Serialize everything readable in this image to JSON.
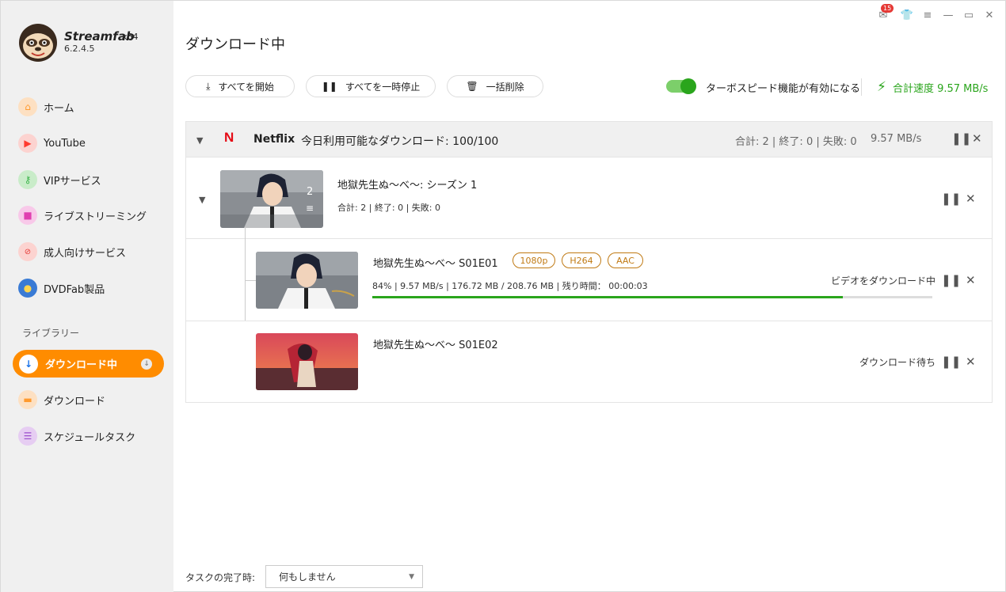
{
  "app": {
    "brand": "Streamfab",
    "arch": "x64",
    "version": "6.2.4.5",
    "notification_count": "15"
  },
  "sidebar": {
    "items": [
      {
        "label": "ホーム",
        "icon": "home-icon",
        "color": "#ff9a2e"
      },
      {
        "label": "YouTube",
        "icon": "youtube-icon",
        "color": "#ff3b30"
      },
      {
        "label": "VIPサービス",
        "icon": "key-icon",
        "color": "#3cb44b"
      },
      {
        "label": "ライブストリーミング",
        "icon": "video-camera-icon",
        "color": "#e040b0"
      },
      {
        "label": "成人向けサービス",
        "icon": "no-18-icon",
        "color": "#e53935"
      },
      {
        "label": "DVDFab製品",
        "icon": "dvdfab-logo-icon",
        "color": "#3a7bd5"
      }
    ],
    "library_label": "ライブラリー",
    "library": [
      {
        "label": "ダウンロード中",
        "icon": "download-arrow-icon",
        "active": true
      },
      {
        "label": "ダウンロード",
        "icon": "folder-icon",
        "color": "#ff9a2e"
      },
      {
        "label": "スケジュールタスク",
        "icon": "schedule-list-icon",
        "color": "#9c4dcc"
      }
    ]
  },
  "main": {
    "title": "ダウンロード中",
    "toolbar": {
      "start_all": "すべてを開始",
      "pause_all": "すべてを一時停止",
      "delete_all": "一括削除"
    },
    "turbo": {
      "label": "ターボスピード機能が有効になる",
      "enabled": true
    },
    "total_speed": "合計速度 9.57 MB/s",
    "group": {
      "service": "Netflix",
      "quota": "今日利用可能なダウンロード: 100/100",
      "stats": "合計: 2 | 終了: 0 | 失敗: 0",
      "speed": "9.57 MB/s"
    },
    "season": {
      "title": "地獄先生ぬ〜べ〜: シーズン 1",
      "count": "2",
      "stats": "合計: 2  |  終了: 0  |  失敗: 0"
    },
    "episodes": [
      {
        "title": "地獄先生ぬ〜べ〜 S01E01",
        "tags": [
          "1080p",
          "H264",
          "AAC"
        ],
        "stats": "84%  |  9.57 MB/s  |  176.72 MB / 208.76 MB  |  残り時間： 00:00:03",
        "progress": 0.84,
        "status": "ビデオをダウンロード中"
      },
      {
        "title": "地獄先生ぬ〜べ〜 S01E02",
        "status": "ダウンロード待ち"
      }
    ],
    "footer": {
      "label": "タスクの完了時:",
      "selected": "何もしません"
    }
  }
}
